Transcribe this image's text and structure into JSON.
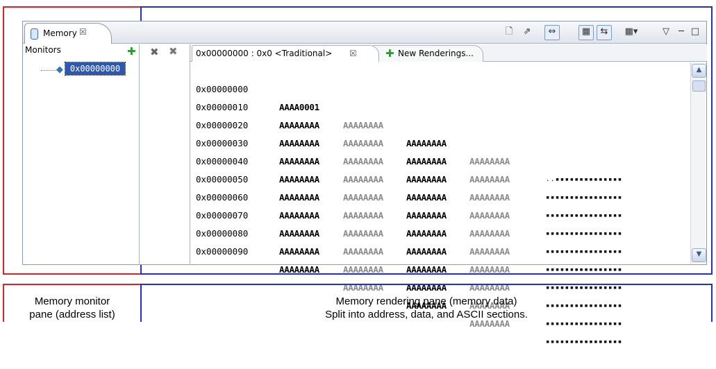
{
  "view": {
    "tab_label": "Memory",
    "close_glyph": "☒",
    "toolbar_icons": [
      "new-monitor-icon",
      "add-rendering-icon",
      "link-icon",
      "toggle-split-pane-icon",
      "switch-icon",
      "view-menu-icon",
      "minimize-icon",
      "maximize-icon"
    ]
  },
  "monitors": {
    "title": "Monitors",
    "items": [
      "0x00000000"
    ]
  },
  "renderings": {
    "tabs": [
      {
        "label": "0x00000000 : 0x0 <Traditional>"
      },
      {
        "label": "New Renderings..."
      }
    ],
    "rows": [
      {
        "address": "0x00000000",
        "words": [
          "AAAA0001",
          "AAAAAAAA",
          "AAAAAAAA",
          "AAAAAAAA"
        ],
        "ascii": "..▪▪▪▪▪▪▪▪▪▪▪▪▪▪"
      },
      {
        "address": "0x00000010",
        "words": [
          "AAAAAAAA",
          "AAAAAAAA",
          "AAAAAAAA",
          "AAAAAAAA"
        ],
        "ascii": "▪▪▪▪▪▪▪▪▪▪▪▪▪▪▪▪"
      },
      {
        "address": "0x00000020",
        "words": [
          "AAAAAAAA",
          "AAAAAAAA",
          "AAAAAAAA",
          "AAAAAAAA"
        ],
        "ascii": "▪▪▪▪▪▪▪▪▪▪▪▪▪▪▪▪"
      },
      {
        "address": "0x00000030",
        "words": [
          "AAAAAAAA",
          "AAAAAAAA",
          "AAAAAAAA",
          "AAAAAAAA"
        ],
        "ascii": "▪▪▪▪▪▪▪▪▪▪▪▪▪▪▪▪"
      },
      {
        "address": "0x00000040",
        "words": [
          "AAAAAAAA",
          "AAAAAAAA",
          "AAAAAAAA",
          "AAAAAAAA"
        ],
        "ascii": "▪▪▪▪▪▪▪▪▪▪▪▪▪▪▪▪"
      },
      {
        "address": "0x00000050",
        "words": [
          "AAAAAAAA",
          "AAAAAAAA",
          "AAAAAAAA",
          "AAAAAAAA"
        ],
        "ascii": "▪▪▪▪▪▪▪▪▪▪▪▪▪▪▪▪"
      },
      {
        "address": "0x00000060",
        "words": [
          "AAAAAAAA",
          "AAAAAAAA",
          "AAAAAAAA",
          "AAAAAAAA"
        ],
        "ascii": "▪▪▪▪▪▪▪▪▪▪▪▪▪▪▪▪"
      },
      {
        "address": "0x00000070",
        "words": [
          "AAAAAAAA",
          "AAAAAAAA",
          "AAAAAAAA",
          "AAAAAAAA"
        ],
        "ascii": "▪▪▪▪▪▪▪▪▪▪▪▪▪▪▪▪"
      },
      {
        "address": "0x00000080",
        "words": [
          "AAAAAAAA",
          "AAAAAAAA",
          "AAAAAAAA",
          "AAAAAAAA"
        ],
        "ascii": "▪▪▪▪▪▪▪▪▪▪▪▪▪▪▪▪"
      },
      {
        "address": "0x00000090",
        "words": [
          "AAAAAAAA",
          "AAAAAAAA",
          "AAAAAAAA",
          "AAAAAAAA"
        ],
        "ascii": "▪▪▪▪▪▪▪▪▪▪▪▪▪▪▪▪"
      }
    ]
  },
  "captions": {
    "left": [
      "Memory monitor",
      "pane (address list)"
    ],
    "right": [
      "Memory rendering pane (memory data)",
      "Split into address, data, and ASCII sections."
    ]
  },
  "colors": {
    "monitor_frame": "#e02020",
    "rendering_frame": "#2030d0",
    "selection": "#2c57b3"
  }
}
